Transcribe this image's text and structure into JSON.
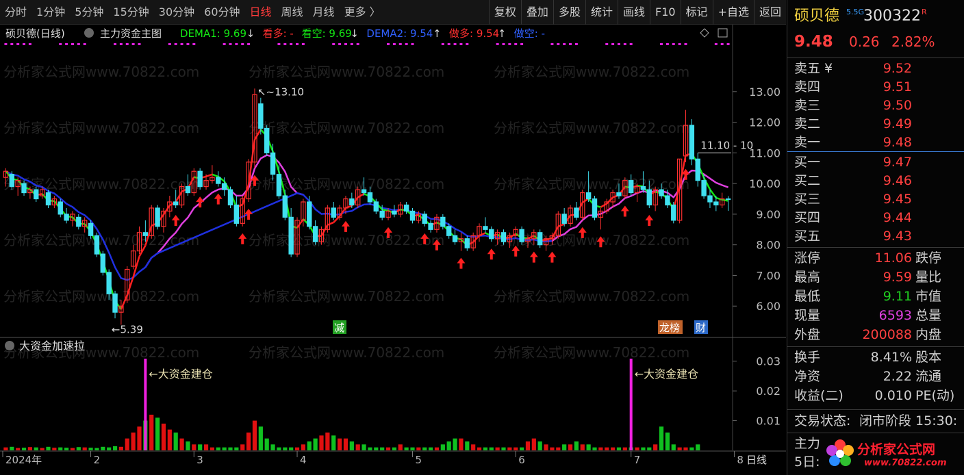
{
  "toolbar": {
    "periods": [
      "分时",
      "1分钟",
      "5分钟",
      "15分钟",
      "30分钟",
      "60分钟",
      "日线",
      "周线",
      "月线",
      "更多 〉"
    ],
    "active_period": "日线",
    "tools": [
      "复权",
      "叠加",
      "多股",
      "统计",
      "画线",
      "F10",
      "标记",
      "+自选",
      "返回"
    ]
  },
  "main_chart": {
    "stock_title": "硕贝德(日线)",
    "indicator_name": "主力资金主图",
    "legend": [
      {
        "text": "DEMA1: 9.69",
        "arrow": "↓",
        "color": "#14e814"
      },
      {
        "text": "看多: -",
        "color": "#ff3030"
      },
      {
        "text": "看空: 9.69",
        "arrow": "↓",
        "color": "#14e814"
      },
      {
        "text": "DEMA2: 9.54",
        "arrow": "↑",
        "color": "#3060ff"
      },
      {
        "text": "做多: 9.54",
        "arrow": "↑",
        "color": "#ff3030"
      },
      {
        "text": "做空: -",
        "color": "#3060ff"
      }
    ],
    "high_label": "13.10",
    "low_label": "5.39",
    "right_label": "11.10 - 10",
    "watermark": "分析家公式网www.70822.com",
    "tags": [
      {
        "text": "减",
        "color": "#23a023"
      },
      {
        "text": "龙榜",
        "color": "#c0622a"
      },
      {
        "text": "财",
        "color": "#2c69c8"
      }
    ]
  },
  "sub_chart": {
    "title": "大资金加速拉",
    "annotations": [
      "←大资金建仓",
      "←大资金建仓"
    ],
    "yaxis": [
      "0.03",
      "0.02",
      "0.01"
    ]
  },
  "xaxis": {
    "labels": [
      "2024年",
      "2",
      "3",
      "4",
      "5",
      "6",
      "7",
      "8"
    ],
    "period_label": "日线"
  },
  "chart_data": {
    "type": "candlestick",
    "title": "硕贝德(日线)",
    "ylim": [
      5.0,
      13.8
    ],
    "yticks": [
      13.0,
      12.0,
      11.0,
      10.0,
      9.0,
      8.0,
      7.0,
      6.0
    ],
    "month_labels": [
      "2024年",
      "2",
      "3",
      "4",
      "5",
      "6",
      "7",
      "8"
    ],
    "candles": [
      {
        "o": 10.2,
        "h": 10.5,
        "l": 9.9,
        "c": 10.4
      },
      {
        "o": 10.3,
        "h": 10.4,
        "l": 9.8,
        "c": 9.9
      },
      {
        "o": 9.9,
        "h": 10.2,
        "l": 9.6,
        "c": 10.1
      },
      {
        "o": 10.0,
        "h": 10.1,
        "l": 9.6,
        "c": 9.7
      },
      {
        "o": 9.7,
        "h": 9.9,
        "l": 9.5,
        "c": 9.8
      },
      {
        "o": 9.8,
        "h": 9.9,
        "l": 9.4,
        "c": 9.5
      },
      {
        "o": 9.6,
        "h": 9.9,
        "l": 9.5,
        "c": 9.8
      },
      {
        "o": 9.7,
        "h": 9.8,
        "l": 9.2,
        "c": 9.3
      },
      {
        "o": 9.3,
        "h": 9.6,
        "l": 9.2,
        "c": 9.5
      },
      {
        "o": 9.4,
        "h": 9.5,
        "l": 8.9,
        "c": 9.0
      },
      {
        "o": 9.0,
        "h": 9.2,
        "l": 8.7,
        "c": 8.8
      },
      {
        "o": 8.8,
        "h": 9.1,
        "l": 8.6,
        "c": 9.0
      },
      {
        "o": 8.9,
        "h": 9.0,
        "l": 8.5,
        "c": 8.6
      },
      {
        "o": 8.6,
        "h": 8.9,
        "l": 8.4,
        "c": 8.8
      },
      {
        "o": 8.7,
        "h": 8.8,
        "l": 8.2,
        "c": 8.3
      },
      {
        "o": 8.3,
        "h": 8.4,
        "l": 7.6,
        "c": 7.7
      },
      {
        "o": 7.7,
        "h": 7.8,
        "l": 7.0,
        "c": 7.1
      },
      {
        "o": 7.1,
        "h": 7.2,
        "l": 6.2,
        "c": 6.4
      },
      {
        "o": 6.4,
        "h": 6.5,
        "l": 5.6,
        "c": 5.8
      },
      {
        "o": 5.8,
        "h": 6.2,
        "l": 5.39,
        "c": 6.0
      },
      {
        "o": 6.2,
        "h": 7.3,
        "l": 6.1,
        "c": 7.2
      },
      {
        "o": 7.3,
        "h": 8.0,
        "l": 7.2,
        "c": 7.8
      },
      {
        "o": 7.8,
        "h": 8.6,
        "l": 7.7,
        "c": 8.4
      },
      {
        "o": 8.4,
        "h": 8.8,
        "l": 8.1,
        "c": 8.3
      },
      {
        "o": 8.3,
        "h": 9.3,
        "l": 8.2,
        "c": 9.2
      },
      {
        "o": 9.2,
        "h": 9.3,
        "l": 8.5,
        "c": 8.6
      },
      {
        "o": 8.6,
        "h": 9.2,
        "l": 8.4,
        "c": 9.1
      },
      {
        "o": 9.1,
        "h": 9.6,
        "l": 8.9,
        "c": 9.4
      },
      {
        "o": 9.4,
        "h": 9.8,
        "l": 9.2,
        "c": 9.3
      },
      {
        "o": 9.3,
        "h": 10.0,
        "l": 9.2,
        "c": 9.9
      },
      {
        "o": 9.9,
        "h": 10.3,
        "l": 9.6,
        "c": 9.7
      },
      {
        "o": 9.7,
        "h": 10.5,
        "l": 9.6,
        "c": 10.4
      },
      {
        "o": 10.4,
        "h": 10.5,
        "l": 9.8,
        "c": 9.9
      },
      {
        "o": 9.9,
        "h": 10.3,
        "l": 9.8,
        "c": 10.1
      },
      {
        "o": 10.1,
        "h": 10.6,
        "l": 10.0,
        "c": 10.2
      },
      {
        "o": 10.2,
        "h": 10.4,
        "l": 9.9,
        "c": 10.0
      },
      {
        "o": 10.0,
        "h": 10.2,
        "l": 9.6,
        "c": 9.8
      },
      {
        "o": 9.8,
        "h": 9.9,
        "l": 9.2,
        "c": 9.3
      },
      {
        "o": 9.3,
        "h": 9.6,
        "l": 8.6,
        "c": 8.7
      },
      {
        "o": 8.7,
        "h": 9.6,
        "l": 8.6,
        "c": 9.5
      },
      {
        "o": 9.5,
        "h": 10.8,
        "l": 9.4,
        "c": 10.7
      },
      {
        "o": 10.7,
        "h": 13.1,
        "l": 10.5,
        "c": 12.9
      },
      {
        "o": 12.6,
        "h": 12.8,
        "l": 11.6,
        "c": 11.8
      },
      {
        "o": 11.8,
        "h": 11.9,
        "l": 10.9,
        "c": 11.0
      },
      {
        "o": 11.0,
        "h": 11.3,
        "l": 10.1,
        "c": 10.3
      },
      {
        "o": 10.3,
        "h": 10.6,
        "l": 9.5,
        "c": 9.6
      },
      {
        "o": 9.6,
        "h": 9.8,
        "l": 8.8,
        "c": 8.9
      },
      {
        "o": 8.9,
        "h": 9.2,
        "l": 7.6,
        "c": 7.7
      },
      {
        "o": 7.7,
        "h": 8.9,
        "l": 7.6,
        "c": 8.8
      },
      {
        "o": 8.8,
        "h": 9.5,
        "l": 8.6,
        "c": 9.4
      },
      {
        "o": 9.4,
        "h": 9.6,
        "l": 8.5,
        "c": 8.6
      },
      {
        "o": 8.6,
        "h": 8.8,
        "l": 8.0,
        "c": 8.1
      },
      {
        "o": 8.1,
        "h": 8.6,
        "l": 8.0,
        "c": 8.5
      },
      {
        "o": 8.5,
        "h": 9.3,
        "l": 8.4,
        "c": 9.2
      },
      {
        "o": 9.2,
        "h": 9.4,
        "l": 8.8,
        "c": 8.9
      },
      {
        "o": 8.9,
        "h": 9.3,
        "l": 8.8,
        "c": 9.2
      },
      {
        "o": 9.2,
        "h": 9.6,
        "l": 9.0,
        "c": 9.5
      },
      {
        "o": 9.5,
        "h": 9.7,
        "l": 9.2,
        "c": 9.3
      },
      {
        "o": 9.3,
        "h": 9.9,
        "l": 9.2,
        "c": 9.8
      },
      {
        "o": 9.8,
        "h": 10.2,
        "l": 9.6,
        "c": 9.7
      },
      {
        "o": 9.7,
        "h": 9.9,
        "l": 9.3,
        "c": 9.4
      },
      {
        "o": 9.4,
        "h": 9.5,
        "l": 9.0,
        "c": 9.1
      },
      {
        "o": 9.1,
        "h": 9.3,
        "l": 8.8,
        "c": 8.9
      },
      {
        "o": 8.9,
        "h": 9.2,
        "l": 8.8,
        "c": 9.1
      },
      {
        "o": 9.1,
        "h": 9.3,
        "l": 8.9,
        "c": 9.0
      },
      {
        "o": 9.0,
        "h": 9.4,
        "l": 8.9,
        "c": 9.3
      },
      {
        "o": 9.3,
        "h": 9.4,
        "l": 9.0,
        "c": 9.1
      },
      {
        "o": 9.1,
        "h": 9.2,
        "l": 8.7,
        "c": 8.8
      },
      {
        "o": 8.8,
        "h": 9.1,
        "l": 8.7,
        "c": 9.0
      },
      {
        "o": 9.0,
        "h": 9.1,
        "l": 8.6,
        "c": 8.7
      },
      {
        "o": 8.7,
        "h": 8.8,
        "l": 8.4,
        "c": 8.5
      },
      {
        "o": 8.5,
        "h": 9.0,
        "l": 8.4,
        "c": 8.9
      },
      {
        "o": 8.9,
        "h": 9.0,
        "l": 8.5,
        "c": 8.6
      },
      {
        "o": 8.6,
        "h": 8.7,
        "l": 8.2,
        "c": 8.3
      },
      {
        "o": 8.3,
        "h": 8.5,
        "l": 8.0,
        "c": 8.1
      },
      {
        "o": 8.1,
        "h": 8.4,
        "l": 7.8,
        "c": 8.2
      },
      {
        "o": 8.2,
        "h": 8.3,
        "l": 7.8,
        "c": 7.9
      },
      {
        "o": 7.9,
        "h": 8.4,
        "l": 7.8,
        "c": 8.3
      },
      {
        "o": 8.3,
        "h": 8.7,
        "l": 8.1,
        "c": 8.6
      },
      {
        "o": 8.6,
        "h": 8.9,
        "l": 8.4,
        "c": 8.5
      },
      {
        "o": 8.5,
        "h": 8.6,
        "l": 8.1,
        "c": 8.2
      },
      {
        "o": 8.2,
        "h": 8.5,
        "l": 8.0,
        "c": 8.4
      },
      {
        "o": 8.4,
        "h": 8.5,
        "l": 8.0,
        "c": 8.1
      },
      {
        "o": 8.1,
        "h": 8.4,
        "l": 7.9,
        "c": 8.3
      },
      {
        "o": 8.3,
        "h": 8.6,
        "l": 8.2,
        "c": 8.5
      },
      {
        "o": 8.5,
        "h": 8.6,
        "l": 8.0,
        "c": 8.1
      },
      {
        "o": 8.1,
        "h": 8.3,
        "l": 7.9,
        "c": 8.2
      },
      {
        "o": 8.2,
        "h": 8.5,
        "l": 8.0,
        "c": 8.4
      },
      {
        "o": 8.4,
        "h": 8.5,
        "l": 7.9,
        "c": 8.0
      },
      {
        "o": 8.0,
        "h": 8.3,
        "l": 7.8,
        "c": 8.2
      },
      {
        "o": 8.2,
        "h": 8.4,
        "l": 8.0,
        "c": 8.3
      },
      {
        "o": 8.3,
        "h": 9.1,
        "l": 8.2,
        "c": 9.0
      },
      {
        "o": 9.0,
        "h": 9.2,
        "l": 8.6,
        "c": 8.7
      },
      {
        "o": 8.7,
        "h": 9.3,
        "l": 8.6,
        "c": 9.2
      },
      {
        "o": 9.2,
        "h": 9.4,
        "l": 8.8,
        "c": 8.9
      },
      {
        "o": 8.9,
        "h": 9.8,
        "l": 8.8,
        "c": 9.7
      },
      {
        "o": 9.7,
        "h": 10.4,
        "l": 9.4,
        "c": 9.5
      },
      {
        "o": 9.5,
        "h": 9.6,
        "l": 8.8,
        "c": 8.9
      },
      {
        "o": 8.9,
        "h": 9.2,
        "l": 8.5,
        "c": 9.1
      },
      {
        "o": 9.1,
        "h": 9.5,
        "l": 9.0,
        "c": 9.4
      },
      {
        "o": 9.4,
        "h": 9.8,
        "l": 9.2,
        "c": 9.7
      },
      {
        "o": 9.7,
        "h": 10.0,
        "l": 9.5,
        "c": 9.6
      },
      {
        "o": 9.6,
        "h": 10.2,
        "l": 9.5,
        "c": 10.1
      },
      {
        "o": 10.1,
        "h": 10.3,
        "l": 9.6,
        "c": 9.7
      },
      {
        "o": 9.7,
        "h": 10.0,
        "l": 9.4,
        "c": 9.9
      },
      {
        "o": 9.9,
        "h": 10.4,
        "l": 9.7,
        "c": 9.8
      },
      {
        "o": 9.8,
        "h": 10.1,
        "l": 9.2,
        "c": 9.3
      },
      {
        "o": 9.3,
        "h": 9.9,
        "l": 9.1,
        "c": 9.8
      },
      {
        "o": 9.8,
        "h": 10.0,
        "l": 9.5,
        "c": 9.6
      },
      {
        "o": 9.6,
        "h": 9.8,
        "l": 9.2,
        "c": 9.3
      },
      {
        "o": 9.3,
        "h": 9.4,
        "l": 8.7,
        "c": 8.8
      },
      {
        "o": 8.8,
        "h": 10.8,
        "l": 8.7,
        "c": 10.8
      },
      {
        "o": 10.9,
        "h": 12.4,
        "l": 10.7,
        "c": 11.9
      },
      {
        "o": 11.9,
        "h": 12.1,
        "l": 10.6,
        "c": 10.8
      },
      {
        "o": 10.8,
        "h": 11.0,
        "l": 9.9,
        "c": 10.1
      },
      {
        "o": 10.1,
        "h": 10.3,
        "l": 9.5,
        "c": 9.6
      },
      {
        "o": 9.6,
        "h": 9.8,
        "l": 9.2,
        "c": 9.4
      },
      {
        "o": 9.4,
        "h": 9.6,
        "l": 9.1,
        "c": 9.3
      },
      {
        "o": 9.3,
        "h": 9.7,
        "l": 9.2,
        "c": 9.5
      },
      {
        "o": 9.5,
        "h": 9.59,
        "l": 9.11,
        "c": 9.48
      }
    ],
    "volume_bars": [
      0.001,
      0.0012,
      0.0008,
      0.0009,
      0.0011,
      0.001,
      0.0008,
      0.0012,
      0.0009,
      0.001,
      0.0009,
      0.0008,
      0.0011,
      0.001,
      0.0009,
      0.0008,
      0.0012,
      0.001,
      0.0014,
      0.0012,
      0.004,
      0.006,
      0.008,
      0.01,
      0.012,
      0.011,
      0.009,
      0.007,
      0.006,
      0.004,
      0.003,
      0.002,
      0.002,
      0.002,
      0.001,
      0.001,
      0.001,
      0.001,
      0.001,
      0.002,
      0.006,
      0.01,
      0.008,
      0.004,
      0.002,
      0.001,
      0.001,
      0.001,
      0.001,
      0.002,
      0.003,
      0.004,
      0.005,
      0.006,
      0.005,
      0.004,
      0.004,
      0.003,
      0.002,
      0.002,
      0.001,
      0.001,
      0.001,
      0.001,
      0.001,
      0.002,
      0.001,
      0.001,
      0.001,
      0.001,
      0.001,
      0.001,
      0.002,
      0.003,
      0.004,
      0.004,
      0.003,
      0.002,
      0.001,
      0.001,
      0.001,
      0.001,
      0.001,
      0.001,
      0.001,
      0.001,
      0.003,
      0.004,
      0.003,
      0.002,
      0.001,
      0.001,
      0.002,
      0.002,
      0.003,
      0.002,
      0.002,
      0.001,
      0.001,
      0.001,
      0.001,
      0.001,
      0.001,
      0.001,
      0.001,
      0.001,
      0.001,
      0.002,
      0.008,
      0.006,
      0.002,
      0.001,
      0.001,
      0.001,
      0.002
    ],
    "accel_spikes": [
      23,
      103
    ],
    "signal_days": [
      28,
      32,
      35,
      39,
      40,
      41,
      56,
      63,
      69,
      71,
      75,
      80,
      84,
      87,
      90,
      95,
      98,
      102,
      106,
      112
    ],
    "dema1_color": "#14e814",
    "dema2_color": "#1f30e0"
  },
  "side_panel": {
    "name": "硕贝德",
    "market_badge": "5.5G",
    "code": "300322",
    "flag": "R",
    "price": "9.48",
    "change": "0.26",
    "change_pct": "2.82%",
    "asks": [
      {
        "label": "卖五",
        "price": "9.52"
      },
      {
        "label": "卖四",
        "price": "9.51"
      },
      {
        "label": "卖三",
        "price": "9.50"
      },
      {
        "label": "卖二",
        "price": "9.49"
      },
      {
        "label": "卖一",
        "price": "9.48"
      }
    ],
    "ask_currency": "¥",
    "bids": [
      {
        "label": "买一",
        "price": "9.47"
      },
      {
        "label": "买二",
        "price": "9.46"
      },
      {
        "label": "买三",
        "price": "9.45"
      },
      {
        "label": "买四",
        "price": "9.44"
      },
      {
        "label": "买五",
        "price": "9.43"
      }
    ],
    "stats": [
      {
        "l": "涨停",
        "v": "11.06",
        "c": "#ff4040",
        "r": "跌停"
      },
      {
        "l": "最高",
        "v": "9.59",
        "c": "#ff4040",
        "r": "量比"
      },
      {
        "l": "最低",
        "v": "9.11",
        "c": "#20d020",
        "r": "市值"
      },
      {
        "l": "现量",
        "v": "6593",
        "c": "#e040e0",
        "r": "总量"
      },
      {
        "l": "外盘",
        "v": "200088",
        "c": "#ff4040",
        "r": "内盘"
      }
    ],
    "fin": [
      {
        "l": "换手",
        "v": "8.41%",
        "r": "股本"
      },
      {
        "l": "净资",
        "v": "2.22",
        "r": "流通"
      },
      {
        "l": "收益(二)",
        "v": "0.010",
        "r": "PE(动)"
      }
    ],
    "status_label": "交易状态:",
    "status_value": "闭市阶段 15:30:",
    "bottom_rows": [
      "主力",
      "5日:"
    ],
    "logo_text": "分析家公式网",
    "logo_url": "www.70822.com"
  }
}
